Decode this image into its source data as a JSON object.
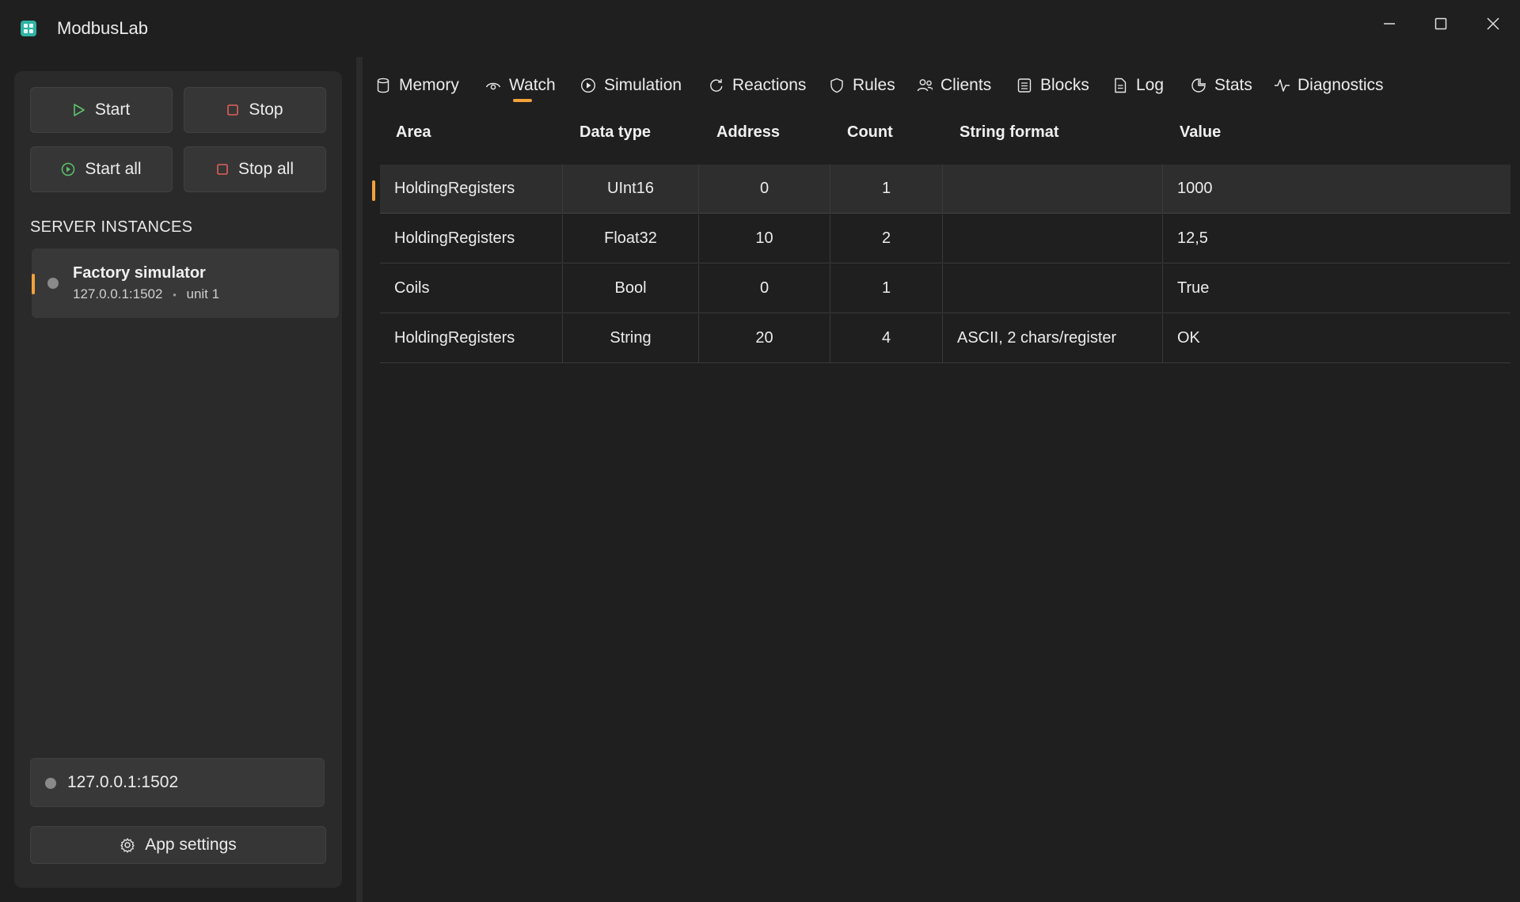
{
  "app": {
    "title": "ModbusLab"
  },
  "sidebar": {
    "start_label": "Start",
    "stop_label": "Stop",
    "start_all_label": "Start all",
    "stop_all_label": "Stop all",
    "section_title": "SERVER INSTANCES",
    "instance": {
      "name": "Factory simulator",
      "address": "127.0.0.1:1502",
      "separator": "•",
      "unit": "unit 1"
    },
    "endpoint": "127.0.0.1:1502",
    "app_settings_label": "App settings"
  },
  "tabs": [
    {
      "label": "Memory",
      "icon": "database-icon"
    },
    {
      "label": "Watch",
      "icon": "eye-icon",
      "active": true
    },
    {
      "label": "Simulation",
      "icon": "play-circle-icon"
    },
    {
      "label": "Reactions",
      "icon": "refresh-icon"
    },
    {
      "label": "Rules",
      "icon": "shield-icon"
    },
    {
      "label": "Clients",
      "icon": "people-icon"
    },
    {
      "label": "Blocks",
      "icon": "list-icon"
    },
    {
      "label": "Log",
      "icon": "document-icon"
    },
    {
      "label": "Stats",
      "icon": "chart-icon"
    },
    {
      "label": "Diagnostics",
      "icon": "pulse-icon"
    }
  ],
  "watch_table": {
    "columns": [
      "Area",
      "Data type",
      "Address",
      "Count",
      "String format",
      "Value"
    ],
    "rows": [
      {
        "area": "HoldingRegisters",
        "data_type": "UInt16",
        "address": "0",
        "count": "1",
        "string_format": "",
        "value": "1000"
      },
      {
        "area": "HoldingRegisters",
        "data_type": "Float32",
        "address": "10",
        "count": "2",
        "string_format": "",
        "value": "12,5"
      },
      {
        "area": "Coils",
        "data_type": "Bool",
        "address": "0",
        "count": "1",
        "string_format": "",
        "value": "True"
      },
      {
        "area": "HoldingRegisters",
        "data_type": "String",
        "address": "20",
        "count": "4",
        "string_format": "ASCII, 2 chars/register",
        "value": "OK"
      }
    ]
  },
  "colors": {
    "accent": "#f2a33a",
    "start_green": "#5cc26b",
    "stop_red": "#e0605a",
    "background": "#1f1f1f"
  }
}
